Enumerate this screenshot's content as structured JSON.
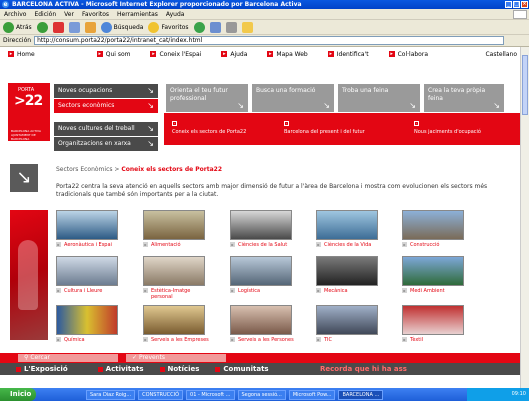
{
  "window": {
    "title": "BARCELONA ACTIVA - Microsoft Internet Explorer proporcionado por Barcelona Activa"
  },
  "menu": [
    "Archivo",
    "Edición",
    "Ver",
    "Favoritos",
    "Herramientas",
    "Ayuda"
  ],
  "toolbar": {
    "back": "Atrás",
    "search": "Búsqueda",
    "favorites": "Favoritos"
  },
  "address": {
    "label": "Dirección",
    "url": "http://consum.porta22/porta22/intranet_cat/index.html"
  },
  "topnav": [
    "Home",
    "Qui som",
    "Coneix l'Espai",
    "Ajuda",
    "Mapa Web",
    "Identifica't",
    "Col·labora"
  ],
  "language": "Castellano",
  "logo": {
    "top": "PORTA",
    "main": ">22",
    "sub": "BARCELONA ACTIVA AJUNTAMENT DE BARCELONA"
  },
  "side": [
    "Noves ocupacions",
    "Sectors econòmics",
    "Noves cultures del treball",
    "Organitzacions en xarxa"
  ],
  "gray": [
    "Orienta el teu futur professional",
    "Busca una formació",
    "Troba una feina",
    "Crea la teva pròpia feina"
  ],
  "band": [
    "Coneix els sectors de Porta22",
    "Barcelona del present i del futur",
    "Nous jaciments d'ocupació"
  ],
  "crumb": {
    "a": "Sectors Econòmics >",
    "b": "Coneix els sectors de Porta22"
  },
  "intro": "Porta22 centra la seva atenció en aquells sectors amb major dimensió de futur a l'àrea de Barcelona i mostra com evolucionen els sectors més tradicionals que també són importants per a la ciutat.",
  "sectors": [
    "Aeronàutica i Espai",
    "Alimentació",
    "Ciències de la Salut",
    "Ciències de la Vida",
    "Construcció",
    "Cultura i Lleure",
    "Estètica-Imatge personal",
    "Logística",
    "Mecànica",
    "Medi Ambient",
    "Química",
    "Serveis a les Empreses",
    "Serveis a les Persones",
    "TIC",
    "Tèxtil"
  ],
  "bottom": {
    "search": "Cercar",
    "prev": "Prevents"
  },
  "nav2": [
    "L'Exposició",
    "Activitats",
    "Notícies",
    "Comunitats"
  ],
  "record": "Recorda que hi ha ass",
  "taskbar": {
    "start": "Inicio",
    "tasks": [
      "Sara Diaz Roig...",
      "CONSTRUCCIÓ",
      "01 - Microsoft ...",
      "Segona sessió...",
      "Microsoft Pow...",
      "BARCELONA ..."
    ],
    "clock": "09:10"
  },
  "colors": {
    "brand": "#e30613",
    "dark": "#4a4a4a"
  }
}
